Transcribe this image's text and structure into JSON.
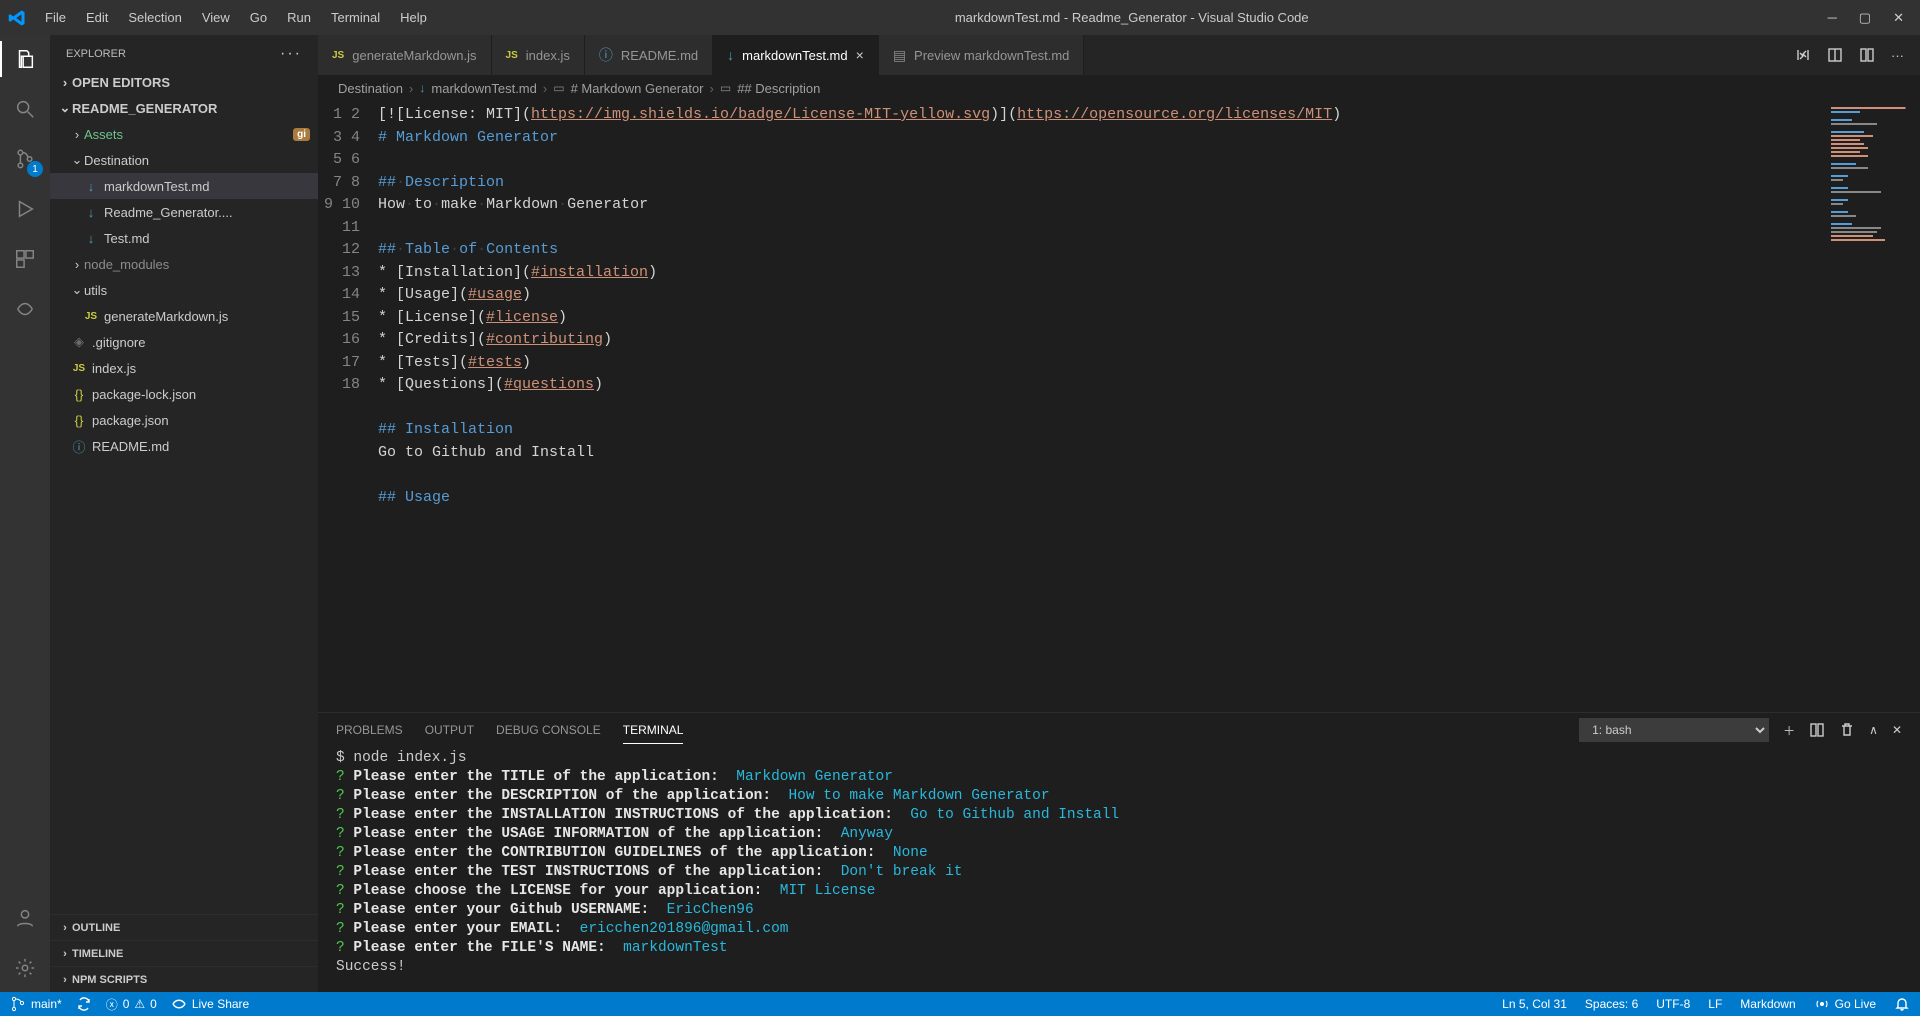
{
  "window": {
    "title": "markdownTest.md - Readme_Generator - Visual Studio Code"
  },
  "menubar": [
    "File",
    "Edit",
    "Selection",
    "View",
    "Go",
    "Run",
    "Terminal",
    "Help"
  ],
  "activitybar": {
    "scm_badge": "1"
  },
  "sidebar": {
    "title": "EXPLORER",
    "sections": {
      "open_editors": "OPEN EDITORS",
      "root": "README_GENERATOR",
      "outline": "OUTLINE",
      "timeline": "TIMELINE",
      "npm": "NPM SCRIPTS"
    },
    "tree": {
      "assets": "Assets",
      "assets_badge": "gi",
      "destination": "Destination",
      "dest_children": [
        "markdownTest.md",
        "Readme_Generator....",
        "Test.md"
      ],
      "node_modules": "node_modules",
      "utils": "utils",
      "utils_children": [
        "generateMarkdown.js"
      ],
      "files": [
        ".gitignore",
        "index.js",
        "package-lock.json",
        "package.json",
        "README.md"
      ]
    }
  },
  "tabs": [
    {
      "label": "generateMarkdown.js",
      "icon": "JS",
      "active": false,
      "close": false
    },
    {
      "label": "index.js",
      "icon": "JS",
      "active": false,
      "close": false
    },
    {
      "label": "README.md",
      "icon": "info",
      "active": false,
      "close": false
    },
    {
      "label": "markdownTest.md",
      "icon": "md",
      "active": true,
      "close": true
    },
    {
      "label": "Preview markdownTest.md",
      "icon": "preview",
      "active": false,
      "close": false
    }
  ],
  "breadcrumbs": [
    "Destination",
    "markdownTest.md",
    "# Markdown Generator",
    "## Description"
  ],
  "editor": {
    "line_count": 18,
    "lines": {
      "l1_a": "[![License: MIT](",
      "l1_b": "https://img.shields.io/badge/License-MIT-yellow.svg",
      "l1_c": ")](",
      "l1_d": "https://opensource.org/licenses/MIT",
      "l1_e": ")",
      "l2": "# Markdown Generator",
      "l4": "## Description",
      "l5": "How to make Markdown Generator",
      "l7": "## Table of Contents",
      "l8_a": "* [Installation](",
      "l8_b": "#installation",
      "l8_c": ")",
      "l9_a": "* [Usage](",
      "l9_b": "#usage",
      "l9_c": ")",
      "l10_a": "* [License](",
      "l10_b": "#license",
      "l10_c": ")",
      "l11_a": "* [Credits](",
      "l11_b": "#contributing",
      "l11_c": ")",
      "l12_a": "* [Tests](",
      "l12_b": "#tests",
      "l12_c": ")",
      "l13_a": "* [Questions](",
      "l13_b": "#questions",
      "l13_c": ")",
      "l15": "## Installation",
      "l16": "Go to Github and Install",
      "l18": "## Usage"
    }
  },
  "panel": {
    "tabs": [
      "PROBLEMS",
      "OUTPUT",
      "DEBUG CONSOLE",
      "TERMINAL"
    ],
    "active_tab": "TERMINAL",
    "shell": "1: bash",
    "terminal": {
      "cmd": "$ node index.js",
      "q1": "Please enter the TITLE of the application:  ",
      "a1": "Markdown Generator",
      "q2": "Please enter the DESCRIPTION of the application:  ",
      "a2": "How to make Markdown Generator",
      "q3": "Please enter the INSTALLATION INSTRUCTIONS of the application:  ",
      "a3": "Go to Github and Install",
      "q4": "Please enter the USAGE INFORMATION of the application:  ",
      "a4": "Anyway",
      "q5": "Please enter the CONTRIBUTION GUIDELINES of the application:  ",
      "a5": "None",
      "q6": "Please enter the TEST INSTRUCTIONS of the application:  ",
      "a6": "Don't break it",
      "q7": "Please choose the LICENSE for your application:  ",
      "a7": "MIT License",
      "q8": "Please enter your Github USERNAME:  ",
      "a8": "EricChen96",
      "q9": "Please enter your EMAIL:  ",
      "a9": "ericchen201896@gmail.com",
      "q10": "Please enter the FILE'S NAME:  ",
      "a10": "markdownTest",
      "success": "Success!"
    }
  },
  "statusbar": {
    "branch": "main*",
    "errors": "0",
    "warnings": "0",
    "live_share": "Live Share",
    "cursor": "Ln 5, Col 31",
    "spaces": "Spaces: 6",
    "encoding": "UTF-8",
    "eol": "LF",
    "lang": "Markdown",
    "go_live": "Go Live"
  }
}
